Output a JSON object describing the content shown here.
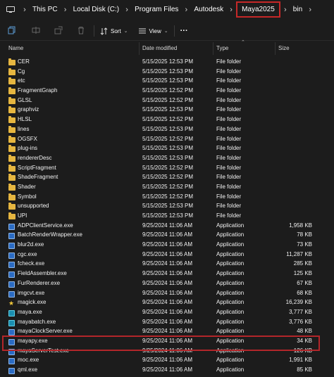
{
  "breadcrumb": {
    "items": [
      "This PC",
      "Local Disk (C:)",
      "Program Files",
      "Autodesk",
      "Maya2025",
      "bin"
    ],
    "separator": "›",
    "highlighted": "Maya2025"
  },
  "toolbar": {
    "sort_label": "Sort",
    "view_label": "View",
    "more_label": "···"
  },
  "columns": {
    "name": "Name",
    "date": "Date modified",
    "type": "Type",
    "size": "Size"
  },
  "files": [
    {
      "name": "CER",
      "date": "5/15/2025 12:53 PM",
      "type": "File folder",
      "size": "",
      "kind": "folder"
    },
    {
      "name": "Cg",
      "date": "5/15/2025 12:53 PM",
      "type": "File folder",
      "size": "",
      "kind": "folder"
    },
    {
      "name": "etc",
      "date": "5/15/2025 12:53 PM",
      "type": "File folder",
      "size": "",
      "kind": "folder"
    },
    {
      "name": "FragmentGraph",
      "date": "5/15/2025 12:52 PM",
      "type": "File folder",
      "size": "",
      "kind": "folder"
    },
    {
      "name": "GLSL",
      "date": "5/15/2025 12:52 PM",
      "type": "File folder",
      "size": "",
      "kind": "folder"
    },
    {
      "name": "graphviz",
      "date": "5/15/2025 12:53 PM",
      "type": "File folder",
      "size": "",
      "kind": "folder"
    },
    {
      "name": "HLSL",
      "date": "5/15/2025 12:52 PM",
      "type": "File folder",
      "size": "",
      "kind": "folder"
    },
    {
      "name": "lines",
      "date": "5/15/2025 12:53 PM",
      "type": "File folder",
      "size": "",
      "kind": "folder"
    },
    {
      "name": "OGSFX",
      "date": "5/15/2025 12:52 PM",
      "type": "File folder",
      "size": "",
      "kind": "folder"
    },
    {
      "name": "plug-ins",
      "date": "5/15/2025 12:53 PM",
      "type": "File folder",
      "size": "",
      "kind": "folder"
    },
    {
      "name": "rendererDesc",
      "date": "5/15/2025 12:53 PM",
      "type": "File folder",
      "size": "",
      "kind": "folder"
    },
    {
      "name": "ScriptFragment",
      "date": "5/15/2025 12:52 PM",
      "type": "File folder",
      "size": "",
      "kind": "folder"
    },
    {
      "name": "ShadeFragment",
      "date": "5/15/2025 12:52 PM",
      "type": "File folder",
      "size": "",
      "kind": "folder"
    },
    {
      "name": "Shader",
      "date": "5/15/2025 12:52 PM",
      "type": "File folder",
      "size": "",
      "kind": "folder"
    },
    {
      "name": "Symbol",
      "date": "5/15/2025 12:52 PM",
      "type": "File folder",
      "size": "",
      "kind": "folder"
    },
    {
      "name": "unsupported",
      "date": "5/15/2025 12:53 PM",
      "type": "File folder",
      "size": "",
      "kind": "folder"
    },
    {
      "name": "UPI",
      "date": "5/15/2025 12:53 PM",
      "type": "File folder",
      "size": "",
      "kind": "folder"
    },
    {
      "name": "ADPClientService.exe",
      "date": "9/25/2024 11:06 AM",
      "type": "Application",
      "size": "1,958 KB",
      "kind": "app"
    },
    {
      "name": "BatchRenderWrapper.exe",
      "date": "9/25/2024 11:06 AM",
      "type": "Application",
      "size": "78 KB",
      "kind": "app"
    },
    {
      "name": "blur2d.exe",
      "date": "9/25/2024 11:06 AM",
      "type": "Application",
      "size": "73 KB",
      "kind": "app"
    },
    {
      "name": "cgc.exe",
      "date": "9/25/2024 11:06 AM",
      "type": "Application",
      "size": "11,287 KB",
      "kind": "app"
    },
    {
      "name": "fcheck.exe",
      "date": "9/25/2024 11:06 AM",
      "type": "Application",
      "size": "285 KB",
      "kind": "app"
    },
    {
      "name": "FieldAssembler.exe",
      "date": "9/25/2024 11:06 AM",
      "type": "Application",
      "size": "125 KB",
      "kind": "app"
    },
    {
      "name": "FurRenderer.exe",
      "date": "9/25/2024 11:06 AM",
      "type": "Application",
      "size": "67 KB",
      "kind": "app"
    },
    {
      "name": "imgcvt.exe",
      "date": "9/25/2024 11:06 AM",
      "type": "Application",
      "size": "68 KB",
      "kind": "app"
    },
    {
      "name": "magick.exe",
      "date": "9/25/2024 11:06 AM",
      "type": "Application",
      "size": "16,239 KB",
      "kind": "star"
    },
    {
      "name": "maya.exe",
      "date": "9/25/2024 11:06 AM",
      "type": "Application",
      "size": "3,777 KB",
      "kind": "maya"
    },
    {
      "name": "mayabatch.exe",
      "date": "9/25/2024 11:06 AM",
      "type": "Application",
      "size": "3,776 KB",
      "kind": "maya"
    },
    {
      "name": "mayaClockServer.exe",
      "date": "9/25/2024 11:06 AM",
      "type": "Application",
      "size": "48 KB",
      "kind": "app"
    },
    {
      "name": "mayapy.exe",
      "date": "9/25/2024 11:06 AM",
      "type": "Application",
      "size": "34 KB",
      "kind": "app"
    },
    {
      "name": "mayaServerTest.exe",
      "date": "9/25/2024 11:06 AM",
      "type": "Application",
      "size": "126 KB",
      "kind": "app"
    },
    {
      "name": "moc.exe",
      "date": "9/25/2024 11:06 AM",
      "type": "Application",
      "size": "1,991 KB",
      "kind": "app"
    },
    {
      "name": "qml.exe",
      "date": "9/25/2024 11:06 AM",
      "type": "Application",
      "size": "85 KB",
      "kind": "app"
    }
  ],
  "highlighted_file": "mayapy.exe",
  "colors": {
    "background": "#1c1c1c",
    "highlight_border": "#b3262a",
    "folder": "#e6b640"
  }
}
